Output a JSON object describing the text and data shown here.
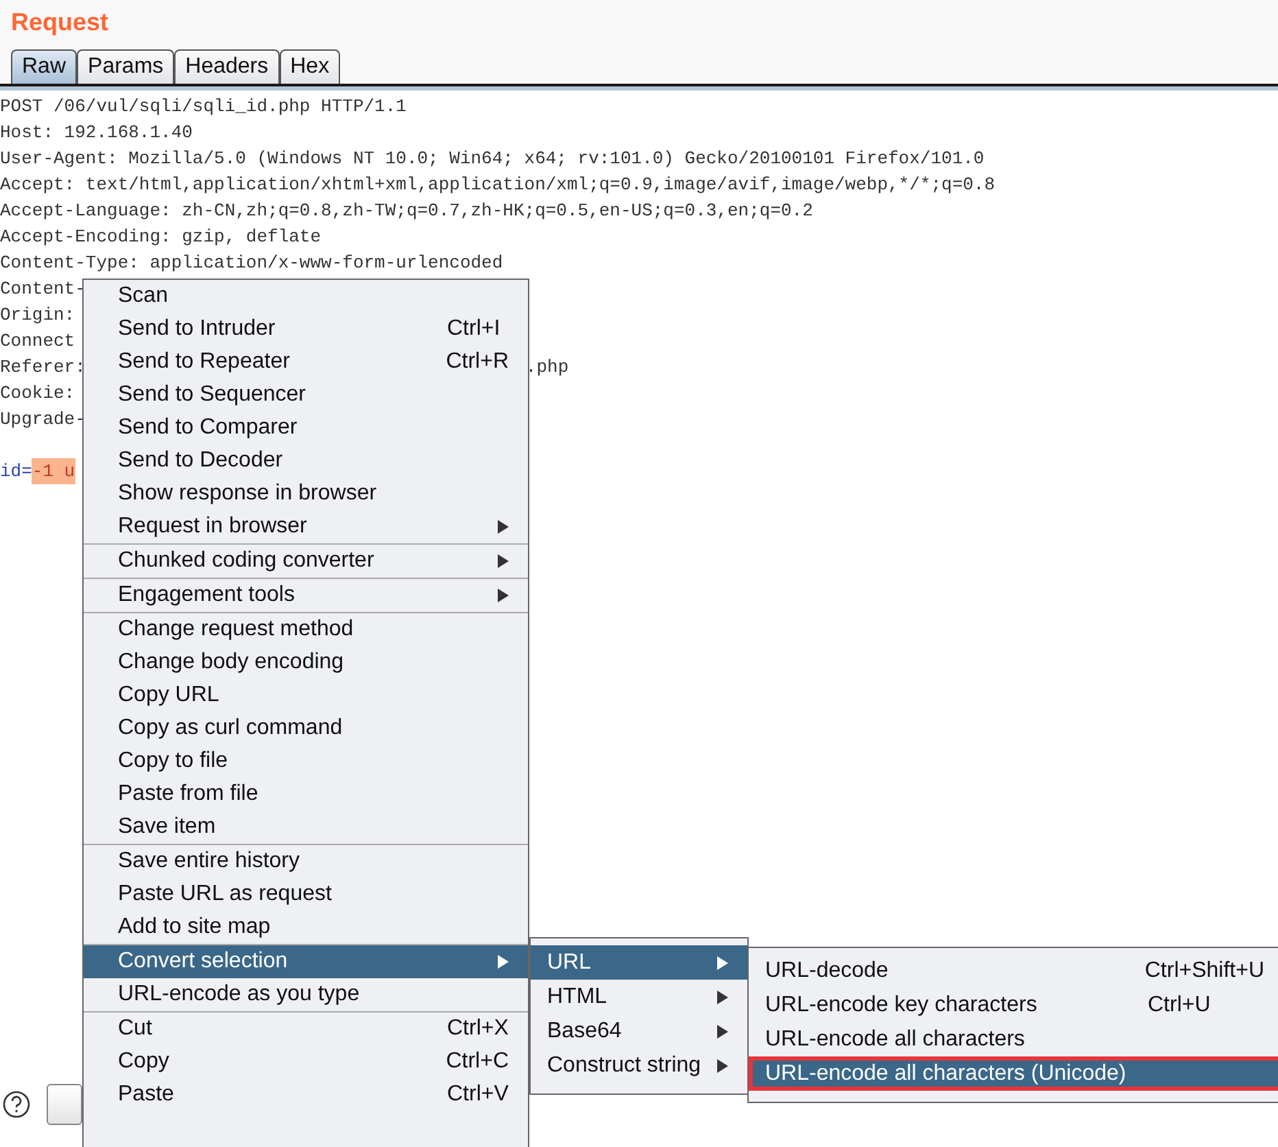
{
  "panel": {
    "title": "Request"
  },
  "tabs": [
    {
      "label": "Raw",
      "selected": true
    },
    {
      "label": "Params",
      "selected": false
    },
    {
      "label": "Headers",
      "selected": false
    },
    {
      "label": "Hex",
      "selected": false
    }
  ],
  "request_lines": [
    {
      "text": "POST /06/vul/sqli/sqli_id.php HTTP/1.1",
      "kind": "header"
    },
    {
      "text": "Host: 192.168.1.40",
      "kind": "header"
    },
    {
      "text": "User-Agent: Mozilla/5.0 (Windows NT 10.0; Win64; x64; rv:101.0) Gecko/20100101 Firefox/101.0",
      "kind": "header"
    },
    {
      "text": "Accept: text/html,application/xhtml+xml,application/xml;q=0.9,image/avif,image/webp,*/*;q=0.8",
      "kind": "header"
    },
    {
      "text": "Accept-Language: zh-CN,zh;q=0.8,zh-TW;q=0.7,zh-HK;q=0.5,en-US;q=0.3,en;q=0.2",
      "kind": "header"
    },
    {
      "text": "Accept-Encoding: gzip, deflate",
      "kind": "header"
    },
    {
      "text": "Content-Type: application/x-www-form-urlencoded",
      "kind": "header"
    },
    {
      "text": "Content-",
      "kind": "header"
    },
    {
      "text": "Origin:",
      "kind": "header"
    },
    {
      "text": "Connect",
      "kind": "header"
    },
    {
      "text": "Referer:",
      "tail": ".php",
      "kind": "header"
    },
    {
      "text": "Cookie:",
      "kind": "header"
    },
    {
      "text": "Upgrade-",
      "kind": "header"
    },
    {
      "kind": "blank"
    },
    {
      "text": "id=",
      "value": "-1 u",
      "kind": "param"
    }
  ],
  "context_menu": {
    "groups": [
      [
        {
          "label": "Scan",
          "submenu": false,
          "selected": false
        },
        {
          "label": "Send to Intruder",
          "shortcut": "Ctrl+I",
          "submenu": false,
          "selected": false
        },
        {
          "label": "Send to Repeater",
          "shortcut": "Ctrl+R",
          "submenu": false,
          "selected": false
        },
        {
          "label": "Send to Sequencer",
          "submenu": false,
          "selected": false
        },
        {
          "label": "Send to Comparer",
          "submenu": false,
          "selected": false
        },
        {
          "label": "Send to Decoder",
          "submenu": false,
          "selected": false
        },
        {
          "label": "Show response in browser",
          "submenu": false,
          "selected": false
        },
        {
          "label": "Request in browser",
          "submenu": true,
          "selected": false
        }
      ],
      [
        {
          "label": "Chunked coding converter",
          "submenu": true,
          "selected": false
        }
      ],
      [
        {
          "label": "Engagement tools",
          "submenu": true,
          "selected": false
        }
      ],
      [
        {
          "label": "Change request method",
          "submenu": false,
          "selected": false
        },
        {
          "label": "Change body encoding",
          "submenu": false,
          "selected": false
        },
        {
          "label": "Copy URL",
          "submenu": false,
          "selected": false
        },
        {
          "label": "Copy as curl command",
          "submenu": false,
          "selected": false
        },
        {
          "label": "Copy to file",
          "submenu": false,
          "selected": false
        },
        {
          "label": "Paste from file",
          "submenu": false,
          "selected": false
        },
        {
          "label": "Save item",
          "submenu": false,
          "selected": false
        }
      ],
      [
        {
          "label": "Save entire history",
          "submenu": false,
          "selected": false
        },
        {
          "label": "Paste URL as request",
          "submenu": false,
          "selected": false
        },
        {
          "label": "Add to site map",
          "submenu": false,
          "selected": false
        }
      ],
      [
        {
          "label": "Convert selection",
          "submenu": true,
          "selected": true
        },
        {
          "label": "URL-encode as you type",
          "submenu": false,
          "selected": false
        }
      ],
      [
        {
          "label": "Cut",
          "shortcut": "Ctrl+X",
          "submenu": false,
          "selected": false
        },
        {
          "label": "Copy",
          "shortcut": "Ctrl+C",
          "submenu": false,
          "selected": false
        },
        {
          "label": "Paste",
          "shortcut": "Ctrl+V",
          "submenu": false,
          "selected": false
        }
      ]
    ]
  },
  "convert_submenu": {
    "items": [
      {
        "label": "URL",
        "submenu": true,
        "selected": true
      },
      {
        "label": "HTML",
        "submenu": true,
        "selected": false
      },
      {
        "label": "Base64",
        "submenu": true,
        "selected": false
      },
      {
        "label": "Construct string",
        "submenu": true,
        "selected": false
      }
    ]
  },
  "url_submenu": {
    "items": [
      {
        "label": "URL-decode",
        "shortcut": "Ctrl+Shift+U",
        "selected": false,
        "outlined": false
      },
      {
        "label": "URL-encode key characters",
        "shortcut": "Ctrl+U",
        "selected": false,
        "outlined": false
      },
      {
        "label": "URL-encode all characters",
        "selected": false,
        "outlined": false
      },
      {
        "label": "URL-encode all characters (Unicode)",
        "selected": true,
        "outlined": true
      }
    ]
  }
}
